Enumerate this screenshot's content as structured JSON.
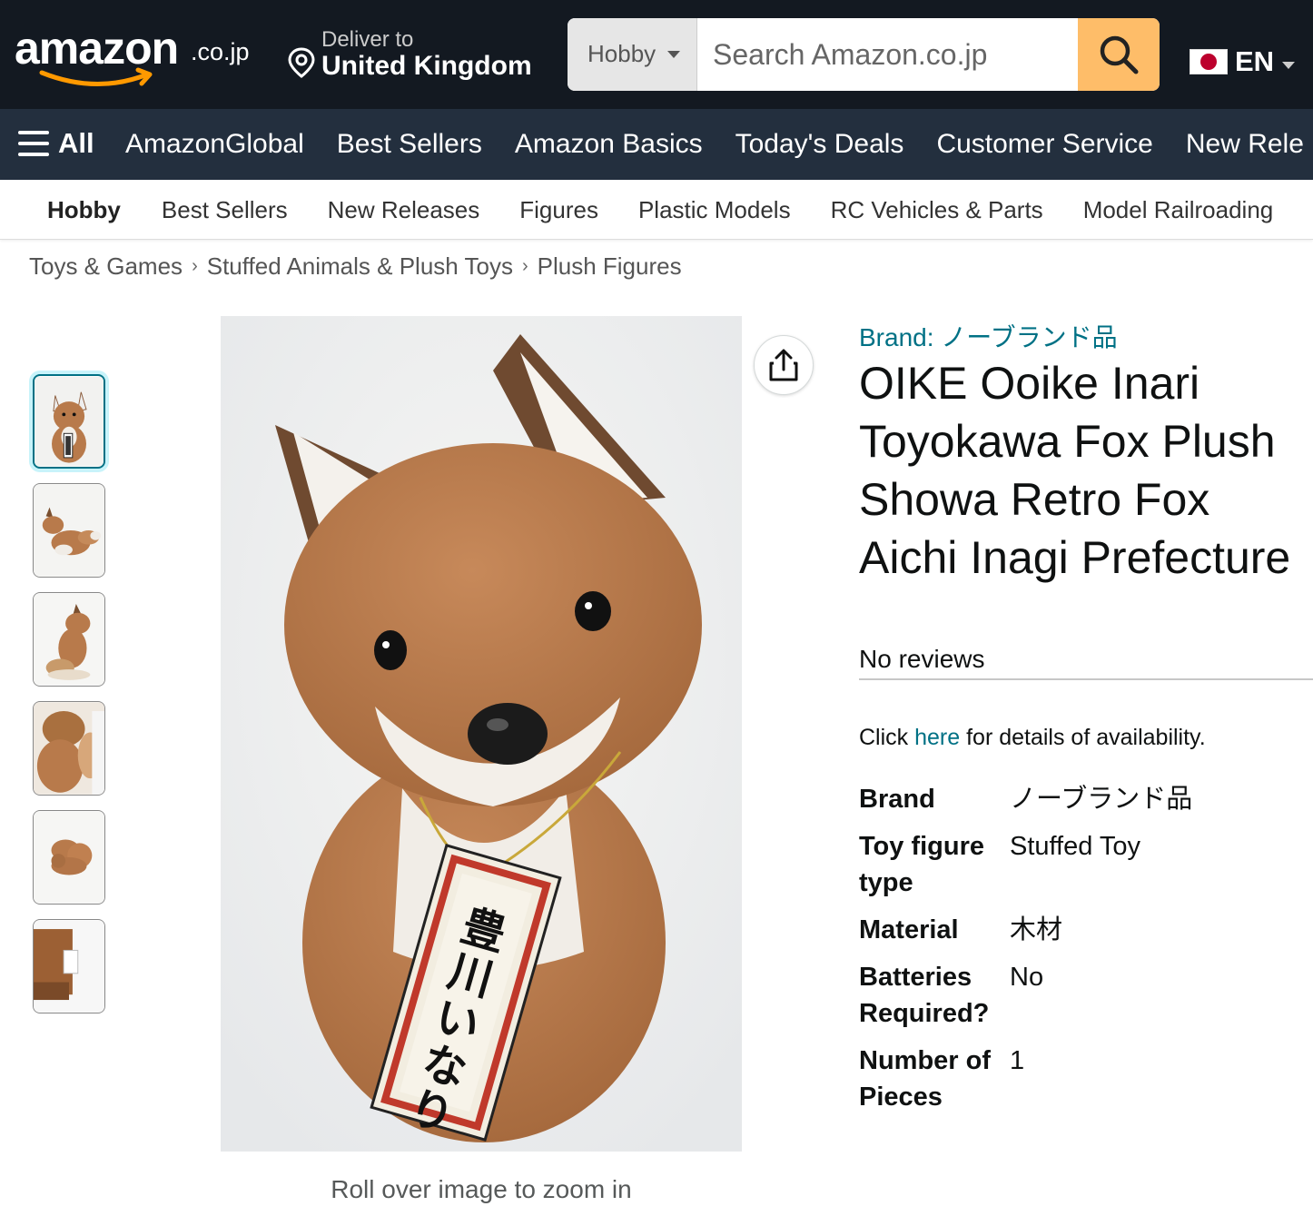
{
  "header": {
    "logo_text": "amazon",
    "logo_suffix": ".co.jp",
    "deliver_line1": "Deliver to",
    "deliver_line2": "United Kingdom",
    "search_category": "Hobby",
    "search_placeholder": "Search Amazon.co.jp",
    "language": "EN",
    "icons": [
      "location-pin-icon",
      "search-icon",
      "japan-flag-icon",
      "hamburger-menu-icon",
      "share-icon"
    ]
  },
  "nav": {
    "all_label": "All",
    "links": [
      "AmazonGlobal",
      "Best Sellers",
      "Amazon Basics",
      "Today's Deals",
      "Customer Service",
      "New Rele"
    ]
  },
  "subnav": {
    "first": "Hobby",
    "items": [
      "Best Sellers",
      "New Releases",
      "Figures",
      "Plastic Models",
      "RC Vehicles & Parts",
      "Model Railroading"
    ]
  },
  "breadcrumb": {
    "items": [
      "Toys & Games",
      "Stuffed Animals & Plush Toys",
      "Plush Figures"
    ],
    "separator": "›"
  },
  "gallery": {
    "thumbnail_count": 6,
    "selected_index": 0,
    "zoom_hint": "Roll over image to zoom in",
    "tag_text": "豊川いなり"
  },
  "product": {
    "brand_link": "Brand: ノーブランド品",
    "title": "OIKE Ooike Inari Toyokawa Fox Plush Showa Retro Fox Aichi Inagi Prefecture",
    "reviews": "No reviews",
    "availability_prefix": "Click ",
    "availability_link": "here",
    "availability_suffix": " for details of availability.",
    "specs": [
      {
        "label": "Brand",
        "value": "ノーブランド品"
      },
      {
        "label": "Toy figure type",
        "value": "Stuffed Toy"
      },
      {
        "label": "Material",
        "value": "木材"
      },
      {
        "label": "Batteries Required?",
        "value": "No"
      },
      {
        "label": "Number of Pieces",
        "value": "1"
      }
    ]
  },
  "colors": {
    "header_bg": "#131921",
    "nav_bg": "#232f3e",
    "search_button": "#febd69",
    "link": "#007185",
    "thumb_selected_ring": "#c8f3fa"
  }
}
